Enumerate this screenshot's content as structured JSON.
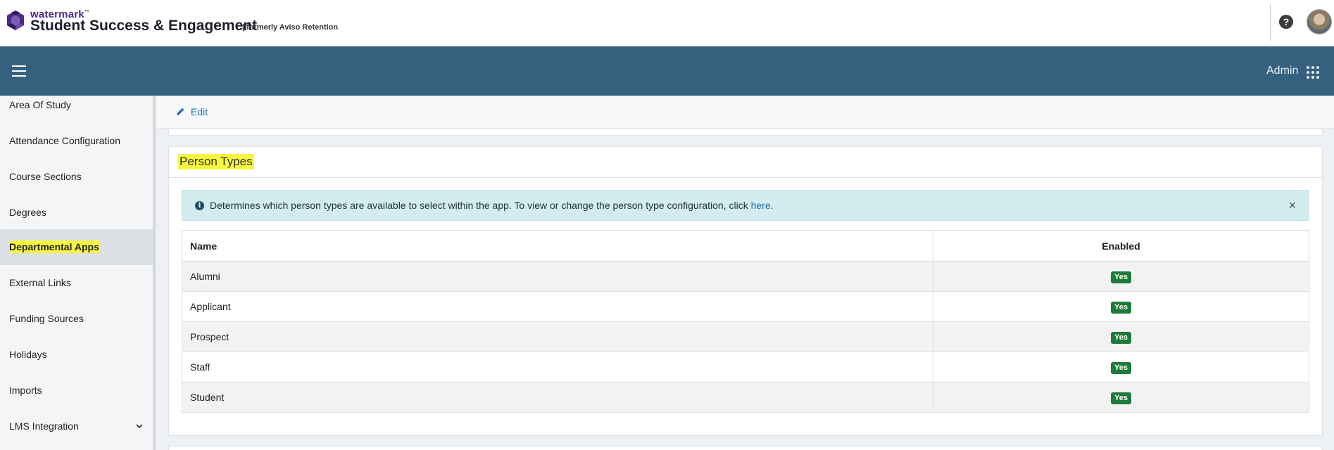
{
  "header": {
    "brand_small": "watermark",
    "brand_tm": "™",
    "brand_main": "Student Success & Engagement",
    "brand_sub": "| formerly Aviso Retention",
    "help_glyph": "?"
  },
  "navbar": {
    "admin_label": "Admin"
  },
  "sidebar": {
    "items": [
      {
        "label": "Area Of Study"
      },
      {
        "label": "Attendance Configuration"
      },
      {
        "label": "Course Sections"
      },
      {
        "label": "Degrees"
      },
      {
        "label": "Departmental Apps",
        "active": true
      },
      {
        "label": "External Links"
      },
      {
        "label": "Funding Sources"
      },
      {
        "label": "Holidays"
      },
      {
        "label": "Imports"
      },
      {
        "label": "LMS Integration",
        "expandable": true
      }
    ]
  },
  "main": {
    "edit_label": "Edit",
    "card": {
      "title": "Person Types",
      "alert": {
        "text": "Determines which person types are available to select within the app. To view or change the person type configuration, click ",
        "link_text": "here",
        "suffix": ".",
        "close_glyph": "×",
        "info_glyph": "i"
      },
      "table": {
        "headers": {
          "name": "Name",
          "enabled": "Enabled"
        },
        "rows": [
          {
            "name": "Alumni",
            "enabled": "Yes"
          },
          {
            "name": "Applicant",
            "enabled": "Yes"
          },
          {
            "name": "Prospect",
            "enabled": "Yes"
          },
          {
            "name": "Staff",
            "enabled": "Yes"
          },
          {
            "name": "Student",
            "enabled": "Yes"
          }
        ]
      }
    }
  },
  "colors": {
    "navbar": "#35617f",
    "badge_green": "#1e7a3a",
    "highlight": "#f7f740",
    "link": "#1f6fb2"
  }
}
